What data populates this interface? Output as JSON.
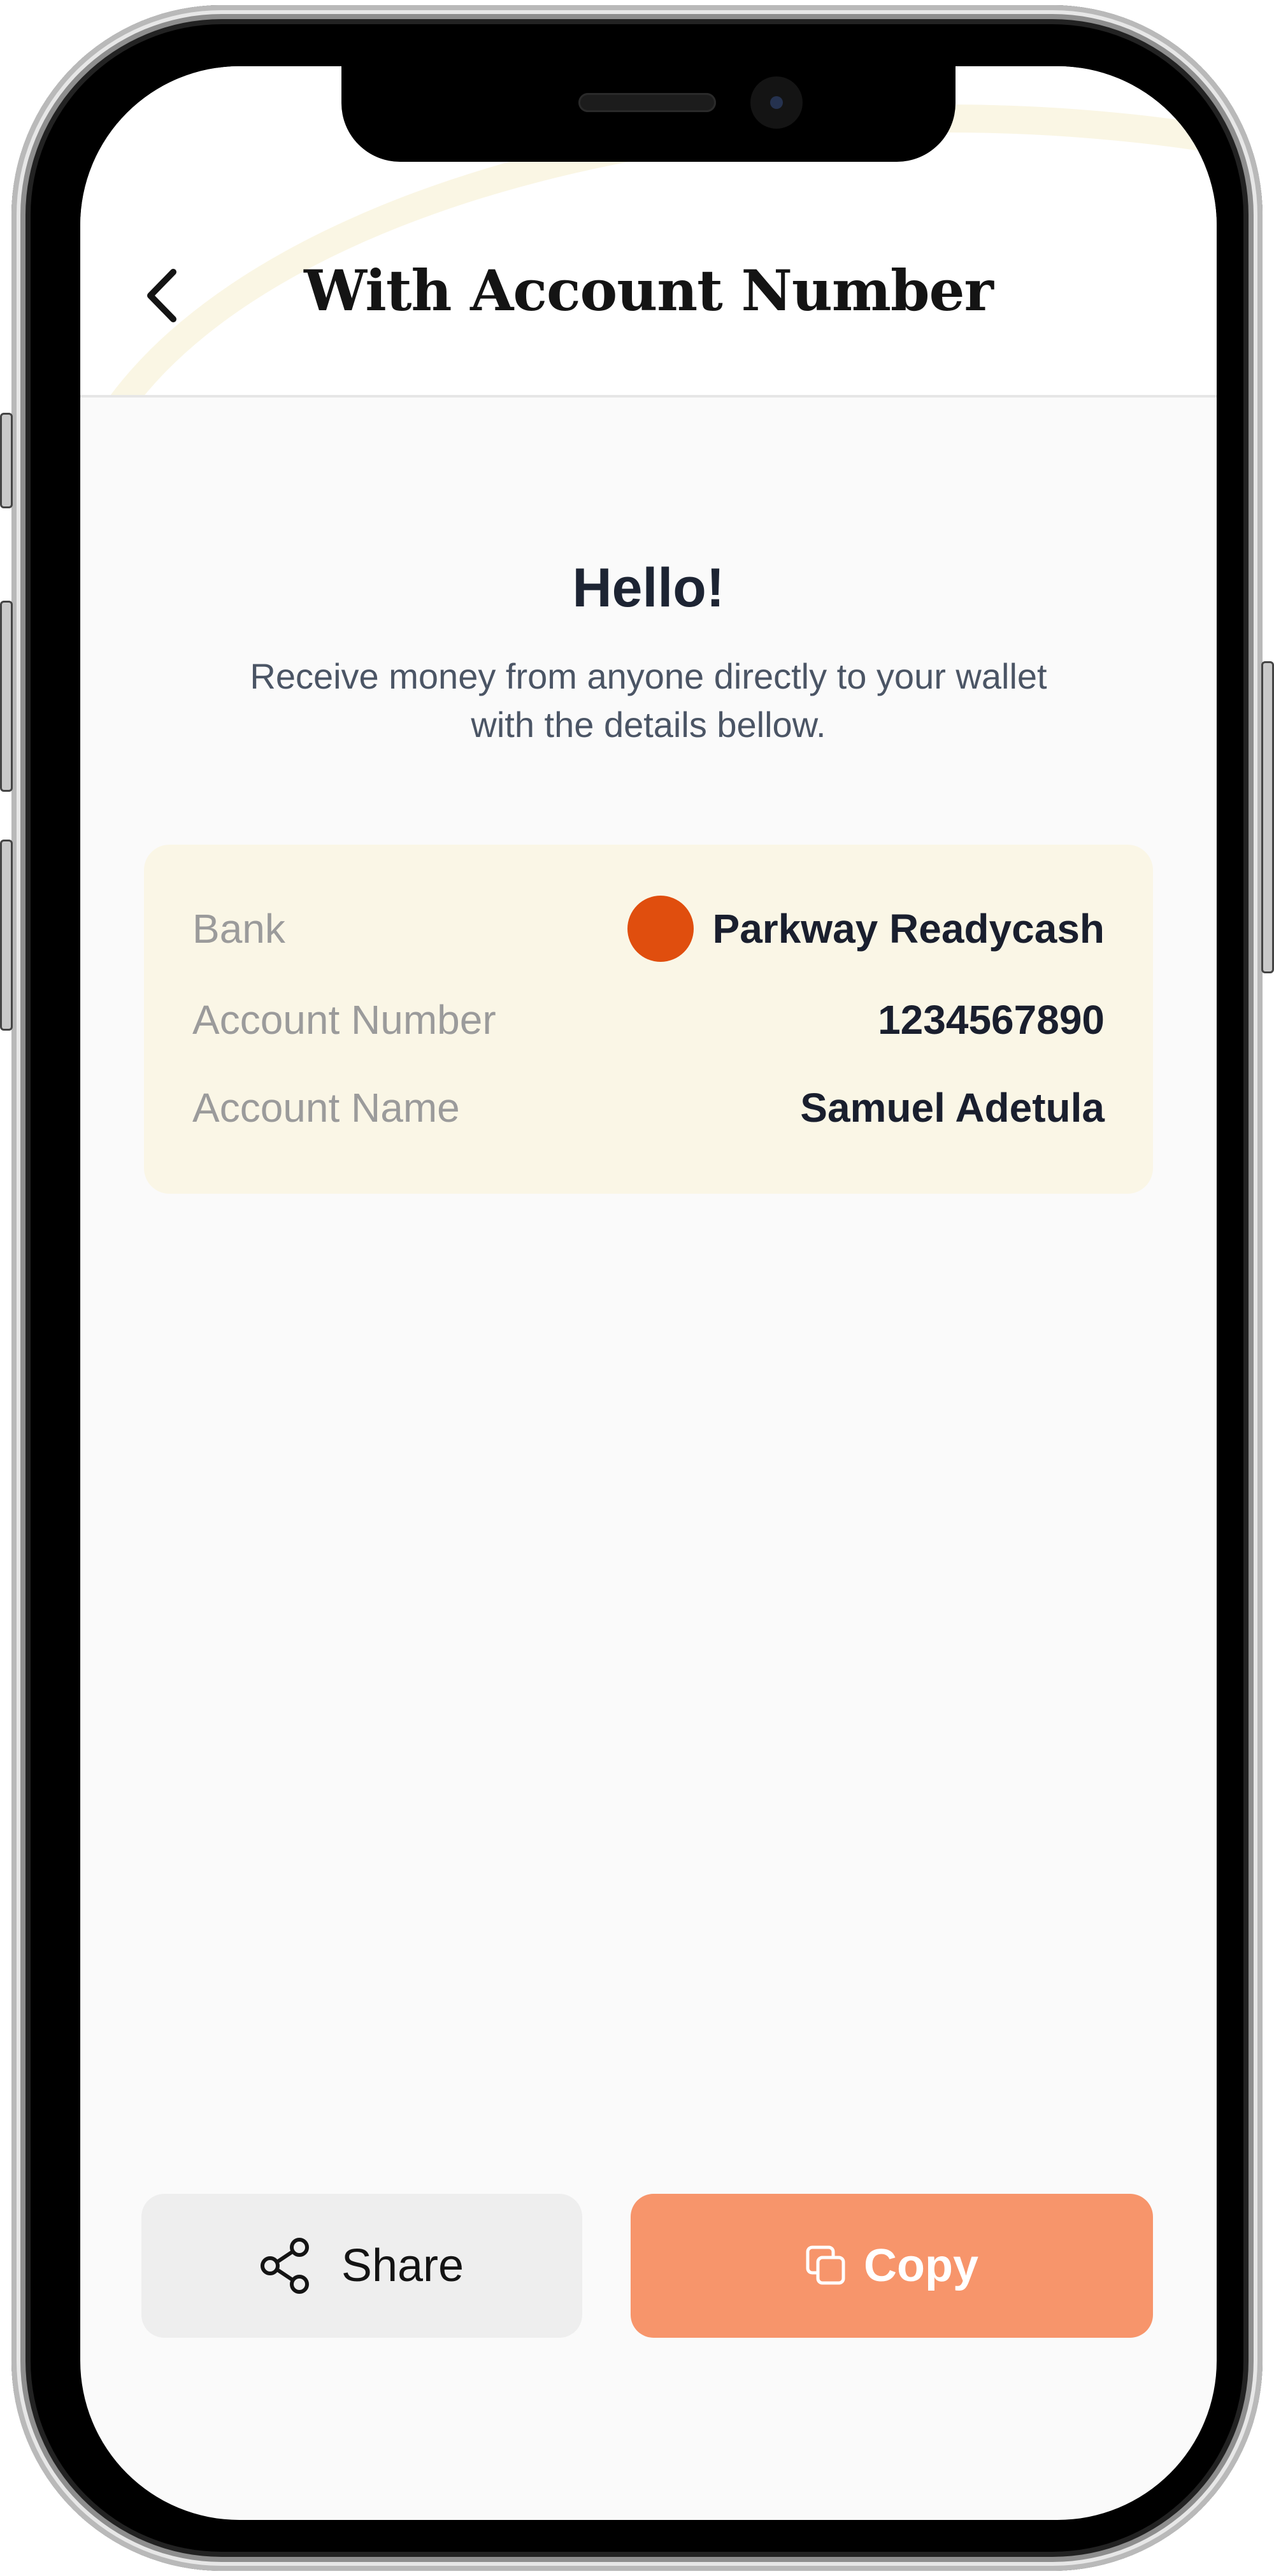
{
  "header": {
    "title": "With Account Number",
    "back_icon": "chevron-left-icon"
  },
  "intro": {
    "greeting": "Hello!",
    "subtitle": "Receive money from anyone directly to your wallet with the details bellow."
  },
  "details": {
    "bank_label": "Bank",
    "bank_value": "Parkway Readycash",
    "bank_logo_color": "#e04e0e",
    "account_number_label": "Account Number",
    "account_number_value": "1234567890",
    "account_name_label": "Account Name",
    "account_name_value": "Samuel Adetula"
  },
  "actions": {
    "share_label": "Share",
    "share_icon": "share-icon",
    "copy_label": "Copy",
    "copy_icon": "copy-icon",
    "copy_color": "#f7956b"
  },
  "colors": {
    "background": "#fafafa",
    "card": "#faf6e6",
    "accent": "#f7956b"
  }
}
